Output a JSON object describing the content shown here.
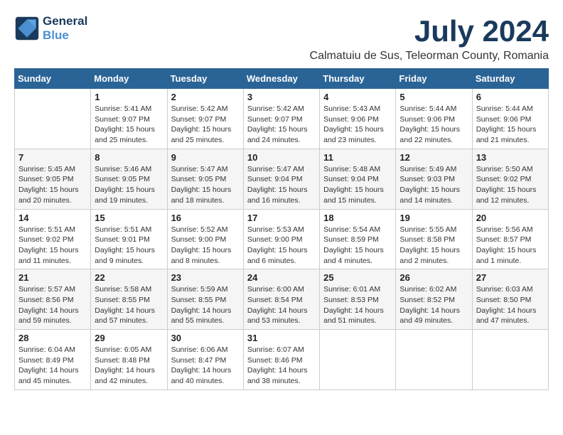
{
  "logo": {
    "line1": "General",
    "line2": "Blue"
  },
  "title": "July 2024",
  "subtitle": "Calmatuiu de Sus, Teleorman County, Romania",
  "days_header": [
    "Sunday",
    "Monday",
    "Tuesday",
    "Wednesday",
    "Thursday",
    "Friday",
    "Saturday"
  ],
  "weeks": [
    [
      {
        "day": "",
        "info": ""
      },
      {
        "day": "1",
        "info": "Sunrise: 5:41 AM\nSunset: 9:07 PM\nDaylight: 15 hours\nand 25 minutes."
      },
      {
        "day": "2",
        "info": "Sunrise: 5:42 AM\nSunset: 9:07 PM\nDaylight: 15 hours\nand 25 minutes."
      },
      {
        "day": "3",
        "info": "Sunrise: 5:42 AM\nSunset: 9:07 PM\nDaylight: 15 hours\nand 24 minutes."
      },
      {
        "day": "4",
        "info": "Sunrise: 5:43 AM\nSunset: 9:06 PM\nDaylight: 15 hours\nand 23 minutes."
      },
      {
        "day": "5",
        "info": "Sunrise: 5:44 AM\nSunset: 9:06 PM\nDaylight: 15 hours\nand 22 minutes."
      },
      {
        "day": "6",
        "info": "Sunrise: 5:44 AM\nSunset: 9:06 PM\nDaylight: 15 hours\nand 21 minutes."
      }
    ],
    [
      {
        "day": "7",
        "info": "Sunrise: 5:45 AM\nSunset: 9:05 PM\nDaylight: 15 hours\nand 20 minutes."
      },
      {
        "day": "8",
        "info": "Sunrise: 5:46 AM\nSunset: 9:05 PM\nDaylight: 15 hours\nand 19 minutes."
      },
      {
        "day": "9",
        "info": "Sunrise: 5:47 AM\nSunset: 9:05 PM\nDaylight: 15 hours\nand 18 minutes."
      },
      {
        "day": "10",
        "info": "Sunrise: 5:47 AM\nSunset: 9:04 PM\nDaylight: 15 hours\nand 16 minutes."
      },
      {
        "day": "11",
        "info": "Sunrise: 5:48 AM\nSunset: 9:04 PM\nDaylight: 15 hours\nand 15 minutes."
      },
      {
        "day": "12",
        "info": "Sunrise: 5:49 AM\nSunset: 9:03 PM\nDaylight: 15 hours\nand 14 minutes."
      },
      {
        "day": "13",
        "info": "Sunrise: 5:50 AM\nSunset: 9:02 PM\nDaylight: 15 hours\nand 12 minutes."
      }
    ],
    [
      {
        "day": "14",
        "info": "Sunrise: 5:51 AM\nSunset: 9:02 PM\nDaylight: 15 hours\nand 11 minutes."
      },
      {
        "day": "15",
        "info": "Sunrise: 5:51 AM\nSunset: 9:01 PM\nDaylight: 15 hours\nand 9 minutes."
      },
      {
        "day": "16",
        "info": "Sunrise: 5:52 AM\nSunset: 9:00 PM\nDaylight: 15 hours\nand 8 minutes."
      },
      {
        "day": "17",
        "info": "Sunrise: 5:53 AM\nSunset: 9:00 PM\nDaylight: 15 hours\nand 6 minutes."
      },
      {
        "day": "18",
        "info": "Sunrise: 5:54 AM\nSunset: 8:59 PM\nDaylight: 15 hours\nand 4 minutes."
      },
      {
        "day": "19",
        "info": "Sunrise: 5:55 AM\nSunset: 8:58 PM\nDaylight: 15 hours\nand 2 minutes."
      },
      {
        "day": "20",
        "info": "Sunrise: 5:56 AM\nSunset: 8:57 PM\nDaylight: 15 hours\nand 1 minute."
      }
    ],
    [
      {
        "day": "21",
        "info": "Sunrise: 5:57 AM\nSunset: 8:56 PM\nDaylight: 14 hours\nand 59 minutes."
      },
      {
        "day": "22",
        "info": "Sunrise: 5:58 AM\nSunset: 8:55 PM\nDaylight: 14 hours\nand 57 minutes."
      },
      {
        "day": "23",
        "info": "Sunrise: 5:59 AM\nSunset: 8:55 PM\nDaylight: 14 hours\nand 55 minutes."
      },
      {
        "day": "24",
        "info": "Sunrise: 6:00 AM\nSunset: 8:54 PM\nDaylight: 14 hours\nand 53 minutes."
      },
      {
        "day": "25",
        "info": "Sunrise: 6:01 AM\nSunset: 8:53 PM\nDaylight: 14 hours\nand 51 minutes."
      },
      {
        "day": "26",
        "info": "Sunrise: 6:02 AM\nSunset: 8:52 PM\nDaylight: 14 hours\nand 49 minutes."
      },
      {
        "day": "27",
        "info": "Sunrise: 6:03 AM\nSunset: 8:50 PM\nDaylight: 14 hours\nand 47 minutes."
      }
    ],
    [
      {
        "day": "28",
        "info": "Sunrise: 6:04 AM\nSunset: 8:49 PM\nDaylight: 14 hours\nand 45 minutes."
      },
      {
        "day": "29",
        "info": "Sunrise: 6:05 AM\nSunset: 8:48 PM\nDaylight: 14 hours\nand 42 minutes."
      },
      {
        "day": "30",
        "info": "Sunrise: 6:06 AM\nSunset: 8:47 PM\nDaylight: 14 hours\nand 40 minutes."
      },
      {
        "day": "31",
        "info": "Sunrise: 6:07 AM\nSunset: 8:46 PM\nDaylight: 14 hours\nand 38 minutes."
      },
      {
        "day": "",
        "info": ""
      },
      {
        "day": "",
        "info": ""
      },
      {
        "day": "",
        "info": ""
      }
    ]
  ]
}
